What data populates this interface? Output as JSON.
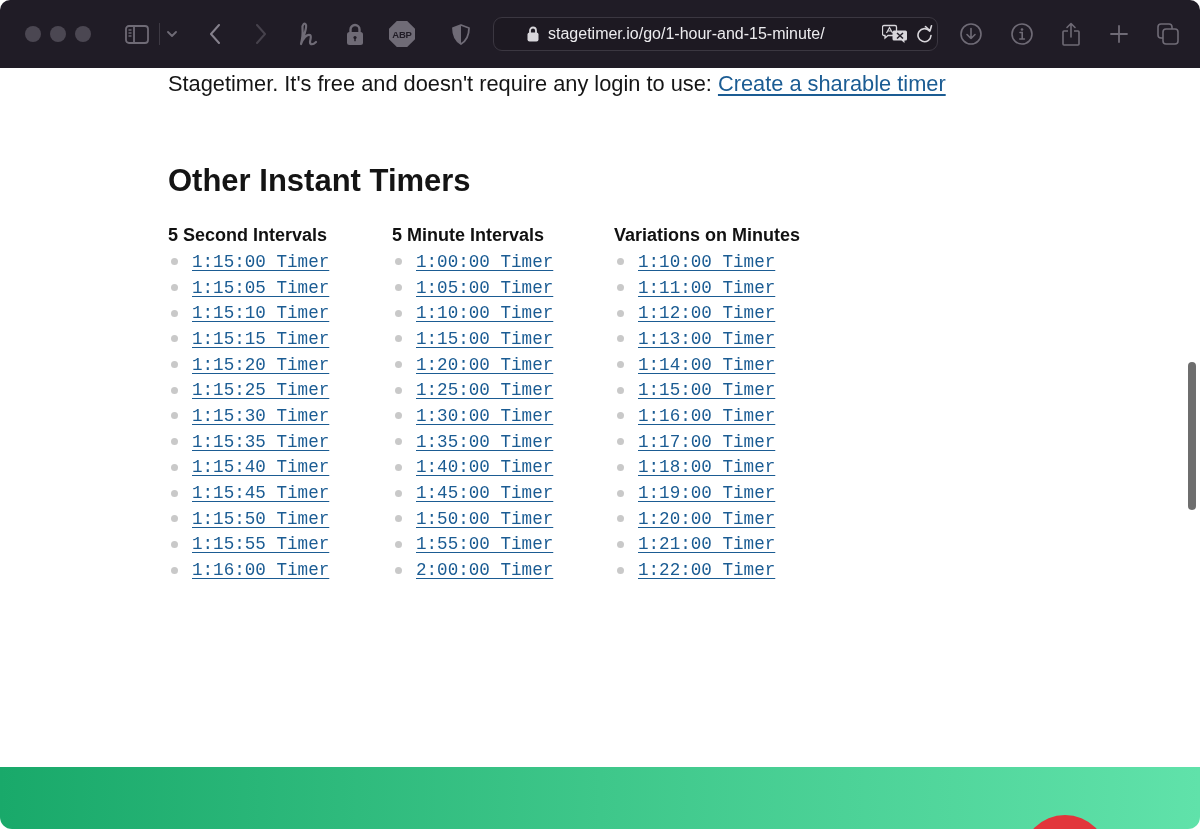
{
  "toolbar": {
    "back": {
      "disabled": false
    },
    "forward": {
      "disabled": true
    },
    "adblock_label": "ABP",
    "address_bar": {
      "url": "stagetimer.io/go/1-hour-and-15-minute/"
    }
  },
  "page": {
    "intro": {
      "text": "Stagetimer. It's free and doesn't require any login to use:",
      "link": "Create a sharable timer"
    },
    "section_title": "Other Instant Timers",
    "columns": [
      {
        "heading": "5 Second Intervals",
        "links": [
          "1:15:00 Timer",
          "1:15:05 Timer",
          "1:15:10 Timer",
          "1:15:15 Timer",
          "1:15:20 Timer",
          "1:15:25 Timer",
          "1:15:30 Timer",
          "1:15:35 Timer",
          "1:15:40 Timer",
          "1:15:45 Timer",
          "1:15:50 Timer",
          "1:15:55 Timer",
          "1:16:00 Timer"
        ]
      },
      {
        "heading": "5 Minute Intervals",
        "links": [
          "1:00:00 Timer",
          "1:05:00 Timer",
          "1:10:00 Timer",
          "1:15:00 Timer",
          "1:20:00 Timer",
          "1:25:00 Timer",
          "1:30:00 Timer",
          "1:35:00 Timer",
          "1:40:00 Timer",
          "1:45:00 Timer",
          "1:50:00 Timer",
          "1:55:00 Timer",
          "2:00:00 Timer"
        ]
      },
      {
        "heading": "Variations on Minutes",
        "links": [
          "1:10:00 Timer",
          "1:11:00 Timer",
          "1:12:00 Timer",
          "1:13:00 Timer",
          "1:14:00 Timer",
          "1:15:00 Timer",
          "1:16:00 Timer",
          "1:17:00 Timer",
          "1:18:00 Timer",
          "1:19:00 Timer",
          "1:20:00 Timer",
          "1:21:00 Timer",
          "1:22:00 Timer"
        ]
      }
    ]
  }
}
